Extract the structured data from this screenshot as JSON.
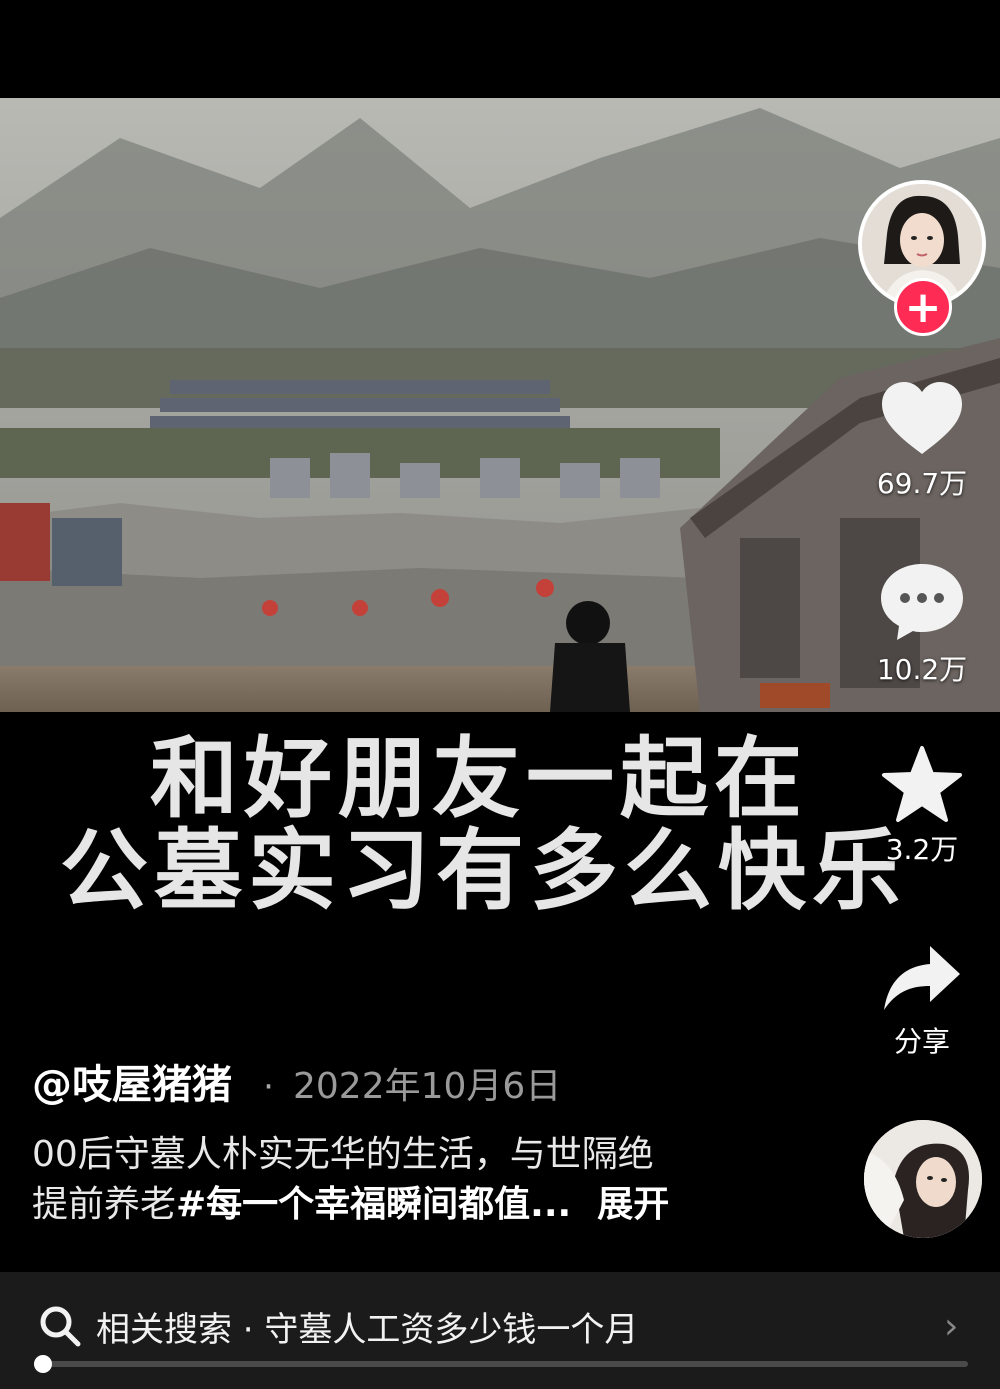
{
  "video": {
    "caption_line1": "和好朋友一起在",
    "caption_line2": "公墓实习有多么快乐"
  },
  "rail": {
    "follow_symbol": "+",
    "like_count": "69.7万",
    "comment_count": "10.2万",
    "favorite_count": "3.2万",
    "share_label": "分享",
    "icons": {
      "like": "heart-icon",
      "comment": "comment-bubble-icon",
      "favorite": "star-icon",
      "share": "share-arrow-icon"
    }
  },
  "post": {
    "author": "@吱屋猪猪",
    "separator": "·",
    "date": "2022年10月6日",
    "desc_line1": "00后守墓人朴实无华的生活，与世隔绝",
    "desc_line2_text": "提前养老",
    "desc_line2_tag": "#每一个幸福瞬间都值...",
    "expand_label": "展开"
  },
  "search": {
    "text": "相关搜索 · 守墓人工资多少钱一个月",
    "arrow": "›"
  },
  "progress": {
    "fraction": 0.01
  },
  "colors": {
    "accent": "#fe2c55",
    "background": "#000000",
    "search_bar": "#1b1b1b"
  }
}
